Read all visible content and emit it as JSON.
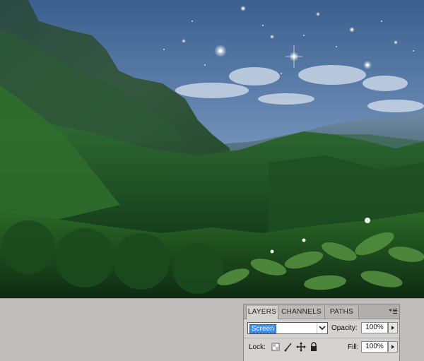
{
  "layers_panel": {
    "tabs": [
      {
        "label": "LAYERS",
        "active": true
      },
      {
        "label": "CHANNELS",
        "active": false
      },
      {
        "label": "PATHS",
        "active": false
      }
    ],
    "menu_icon": "panel-menu-icon",
    "blend_mode": "Screen",
    "opacity_label": "Opacity:",
    "opacity_value": "100%",
    "lock_label": "Lock:",
    "lock_icons": [
      "lock-transparent-pixels-icon",
      "lock-image-pixels-icon",
      "lock-position-icon",
      "lock-all-icon"
    ],
    "fill_label": "Fill:",
    "fill_value": "100%"
  },
  "colors": {
    "sky_top": "#3b5f8f",
    "sky_bottom": "#9fb4cf",
    "foliage_dark": "#143a1a",
    "foliage_mid": "#2d6b28",
    "highlight_blue": "#3d8ee8"
  }
}
